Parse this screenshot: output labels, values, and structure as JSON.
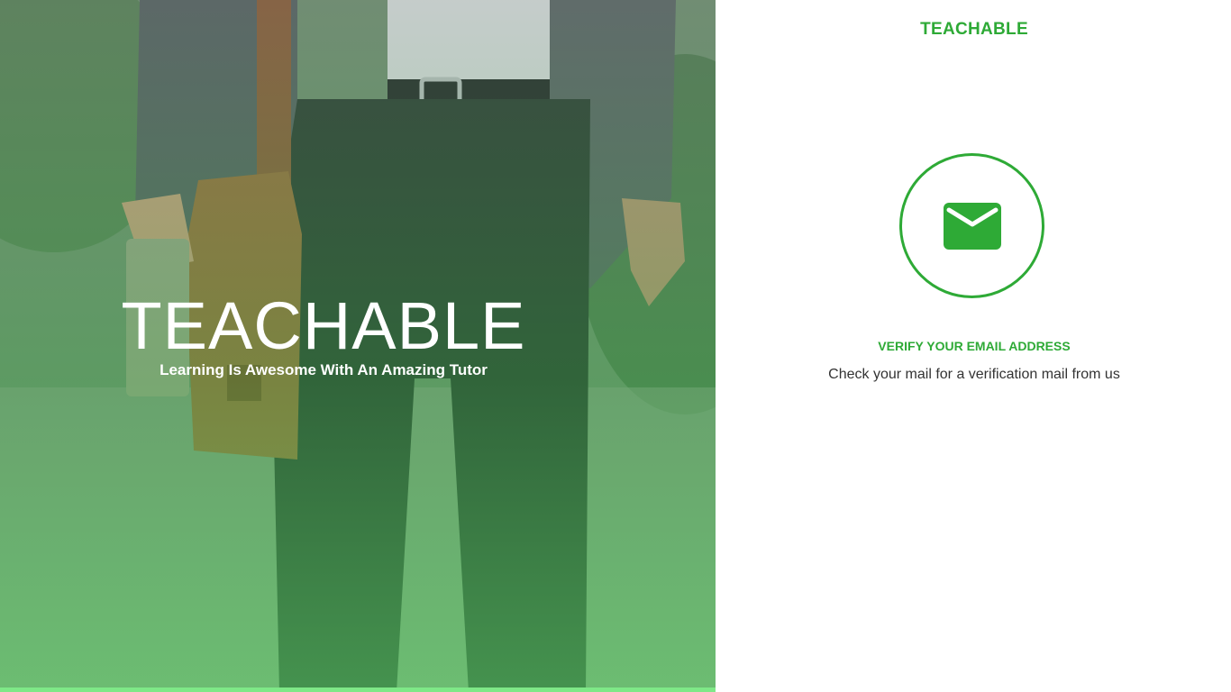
{
  "hero": {
    "title": "TEACHABLE",
    "tagline": "Learning Is Awesome With An Amazing Tutor",
    "image_description_icon": "man-with-satchel-photo"
  },
  "panel": {
    "brand": "TEACHABLE",
    "icon": "envelope-icon",
    "verify_title": "VERIFY YOUR EMAIL ADDRESS",
    "verify_message": "Check your mail for a verification mail from us"
  },
  "colors": {
    "accent": "#2eaa36",
    "text": "#333333",
    "background": "#ffffff"
  }
}
